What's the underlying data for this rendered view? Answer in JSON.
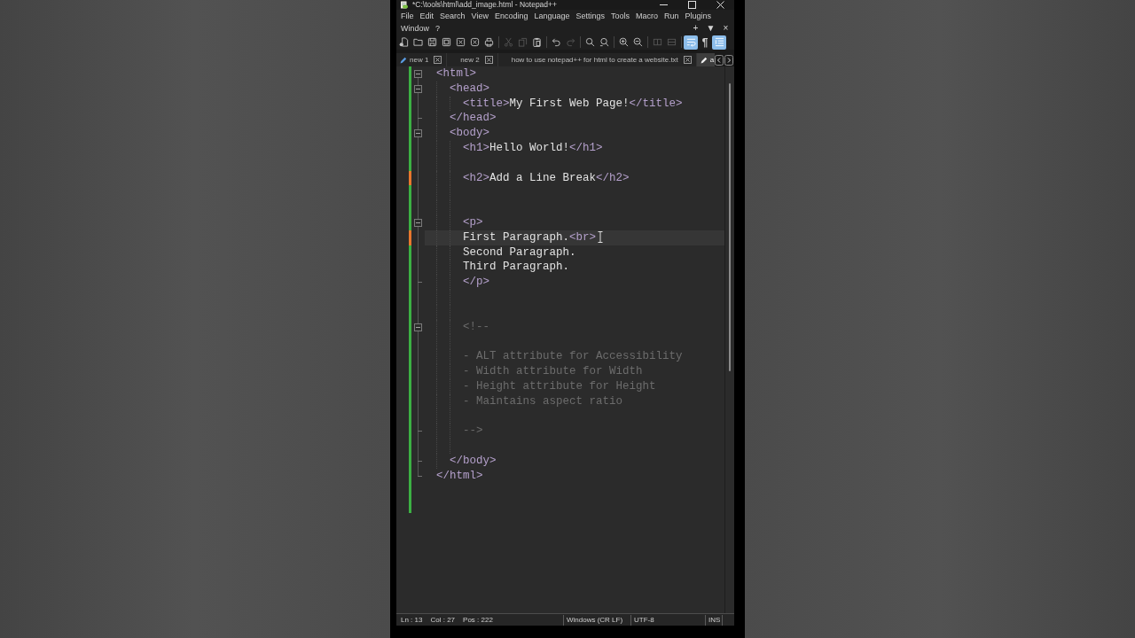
{
  "title_bar": {
    "title": "*C:\\tools\\html\\add_image.html - Notepad++"
  },
  "menu_rows": [
    [
      "File",
      "Edit",
      "Search",
      "View",
      "Encoding",
      "Language",
      "Settings",
      "Tools",
      "Macro",
      "Run",
      "Plugins"
    ],
    [
      "Window",
      "?"
    ]
  ],
  "menu_controls": [
    "+",
    "▼",
    "×"
  ],
  "toolbar": [
    [
      {
        "kind": "icon",
        "disabled": false,
        "selected": false
      },
      {
        "kind": "icon",
        "disabled": false,
        "selected": false
      },
      {
        "kind": "icon",
        "disabled": false,
        "selected": false
      },
      {
        "kind": "icon",
        "disabled": false,
        "selected": false
      },
      {
        "kind": "icon",
        "disabled": false,
        "selected": false
      },
      {
        "kind": "icon",
        "disabled": false,
        "selected": false
      },
      {
        "kind": "icon",
        "disabled": false,
        "selected": false
      }
    ],
    [
      {
        "kind": "icon",
        "disabled": true,
        "selected": false
      },
      {
        "kind": "icon",
        "disabled": true,
        "selected": false
      },
      {
        "kind": "icon",
        "disabled": false,
        "selected": false
      }
    ],
    [
      {
        "kind": "icon",
        "disabled": false,
        "selected": false
      },
      {
        "kind": "icon",
        "disabled": true,
        "selected": false
      }
    ],
    [
      {
        "kind": "icon",
        "disabled": false,
        "selected": false
      },
      {
        "kind": "icon",
        "disabled": false,
        "selected": false
      }
    ],
    [
      {
        "kind": "icon",
        "disabled": false,
        "selected": false
      },
      {
        "kind": "icon",
        "disabled": false,
        "selected": false
      }
    ],
    [
      {
        "kind": "icon",
        "disabled": true,
        "selected": false
      },
      {
        "kind": "icon",
        "disabled": true,
        "selected": false
      }
    ],
    [
      {
        "kind": "icon",
        "disabled": false,
        "selected": true
      },
      {
        "kind": "glyph",
        "label": "¶",
        "disabled": false,
        "selected": false
      },
      {
        "kind": "icon",
        "disabled": false,
        "selected": true
      }
    ]
  ],
  "tabs": [
    {
      "label": "new 1",
      "modified": true,
      "closable": true,
      "selected": false
    },
    {
      "label": "new 2",
      "modified": false,
      "closable": true,
      "selected": false
    },
    {
      "label": "how to use notepad++ for html to create a website.txt",
      "modified": false,
      "closable": true,
      "selected": false
    },
    {
      "label": "a",
      "modified": true,
      "closable": false,
      "selected": true
    }
  ],
  "editor": {
    "lines": [
      {
        "kind": "code",
        "tokens": [
          {
            "kind": "tag",
            "text": "<html>"
          }
        ],
        "fold_start": true,
        "fold_end": false,
        "modified": false,
        "current": false,
        "children": [
          {
            "kind": "code",
            "tokens": [
              {
                "kind": "tag",
                "text": "<head>"
              }
            ],
            "fold_start": true,
            "fold_end": false,
            "modified": false,
            "current": false,
            "children": [
              {
                "kind": "code",
                "tokens": [
                  {
                    "kind": "tag",
                    "text": "<title>"
                  },
                  {
                    "kind": "text",
                    "text": "My First Web Page!"
                  },
                  {
                    "kind": "tag",
                    "text": "</title>"
                  }
                ],
                "fold_start": false,
                "fold_end": false,
                "modified": false,
                "current": false
              }
            ]
          },
          {
            "kind": "code",
            "tokens": [
              {
                "kind": "tag",
                "text": "</head>"
              }
            ],
            "fold_start": false,
            "fold_end": true,
            "modified": false,
            "current": false
          },
          {
            "kind": "code",
            "tokens": [
              {
                "kind": "tag",
                "text": "<body>"
              }
            ],
            "fold_start": true,
            "fold_end": false,
            "modified": false,
            "current": false,
            "children": [
              {
                "kind": "code",
                "tokens": [
                  {
                    "kind": "tag",
                    "text": "<h1>"
                  },
                  {
                    "kind": "text",
                    "text": "Hello World!"
                  },
                  {
                    "kind": "tag",
                    "text": "</h1>"
                  }
                ],
                "fold_start": false,
                "fold_end": false,
                "modified": false,
                "current": false
              },
              {
                "kind": "blank",
                "fold_start": false,
                "fold_end": false,
                "modified": false,
                "current": false
              },
              {
                "kind": "code",
                "tokens": [
                  {
                    "kind": "tag",
                    "text": "<h2>"
                  },
                  {
                    "kind": "text",
                    "text": "Add a Line Break"
                  },
                  {
                    "kind": "tag",
                    "text": "</h2>"
                  }
                ],
                "fold_start": false,
                "fold_end": false,
                "modified": true,
                "current": false
              },
              {
                "kind": "blank",
                "fold_start": false,
                "fold_end": false,
                "modified": false,
                "current": false
              },
              {
                "kind": "blank",
                "fold_start": false,
                "fold_end": false,
                "modified": false,
                "current": false
              },
              {
                "kind": "code",
                "tokens": [
                  {
                    "kind": "tag",
                    "text": "<p>"
                  }
                ],
                "fold_start": true,
                "fold_end": false,
                "modified": false,
                "current": false
              },
              {
                "kind": "code",
                "tokens": [
                  {
                    "kind": "text",
                    "text": "First Paragraph."
                  },
                  {
                    "kind": "tag",
                    "text": "<br>"
                  }
                ],
                "fold_start": false,
                "fold_end": false,
                "modified": true,
                "current": true
              },
              {
                "kind": "code",
                "tokens": [
                  {
                    "kind": "text",
                    "text": "Second Paragraph."
                  }
                ],
                "fold_start": false,
                "fold_end": false,
                "modified": false,
                "current": false
              },
              {
                "kind": "code",
                "tokens": [
                  {
                    "kind": "text",
                    "text": "Third Paragraph."
                  }
                ],
                "fold_start": false,
                "fold_end": false,
                "modified": false,
                "current": false
              },
              {
                "kind": "code",
                "tokens": [
                  {
                    "kind": "tag",
                    "text": "</p>"
                  }
                ],
                "fold_start": false,
                "fold_end": true,
                "modified": false,
                "current": false
              },
              {
                "kind": "blank",
                "fold_start": false,
                "fold_end": false,
                "modified": false,
                "current": false
              },
              {
                "kind": "blank",
                "fold_start": false,
                "fold_end": false,
                "modified": false,
                "current": false
              },
              {
                "kind": "code",
                "tokens": [
                  {
                    "kind": "comment",
                    "text": "<!--"
                  }
                ],
                "fold_start": true,
                "fold_end": false,
                "modified": false,
                "current": false
              },
              {
                "kind": "blank",
                "fold_start": false,
                "fold_end": false,
                "modified": false,
                "current": false
              },
              {
                "kind": "code",
                "tokens": [
                  {
                    "kind": "comment",
                    "text": "- ALT attribute for Accessibility"
                  }
                ],
                "fold_start": false,
                "fold_end": false,
                "modified": false,
                "current": false
              },
              {
                "kind": "code",
                "tokens": [
                  {
                    "kind": "comment",
                    "text": "- Width attribute for Width"
                  }
                ],
                "fold_start": false,
                "fold_end": false,
                "modified": false,
                "current": false
              },
              {
                "kind": "code",
                "tokens": [
                  {
                    "kind": "comment",
                    "text": "- Height attribute for Height"
                  }
                ],
                "fold_start": false,
                "fold_end": false,
                "modified": false,
                "current": false
              },
              {
                "kind": "code",
                "tokens": [
                  {
                    "kind": "comment",
                    "text": "- Maintains aspect ratio"
                  }
                ],
                "fold_start": false,
                "fold_end": false,
                "modified": false,
                "current": false
              },
              {
                "kind": "blank",
                "fold_start": false,
                "fold_end": false,
                "modified": false,
                "current": false
              },
              {
                "kind": "code",
                "tokens": [
                  {
                    "kind": "comment",
                    "text": "-->"
                  }
                ],
                "fold_start": false,
                "fold_end": true,
                "modified": false,
                "current": false
              },
              {
                "kind": "blank",
                "fold_start": false,
                "fold_end": false,
                "modified": false,
                "current": false
              }
            ]
          },
          {
            "kind": "code",
            "tokens": [
              {
                "kind": "tag",
                "text": "</body>"
              }
            ],
            "fold_start": false,
            "fold_end": true,
            "modified": false,
            "current": false
          }
        ]
      },
      {
        "kind": "code",
        "tokens": [
          {
            "kind": "tag",
            "text": "</html>"
          }
        ],
        "fold_start": false,
        "fold_end": true,
        "modified": false,
        "current": false
      },
      {
        "kind": "blank",
        "fold_start": false,
        "fold_end": false,
        "modified": false,
        "current": false
      },
      {
        "kind": "blank",
        "fold_start": false,
        "fold_end": false,
        "modified": false,
        "current": false
      }
    ]
  },
  "status_bar": {
    "position": [
      "Ln : 13",
      "Col : 27",
      "Pos : 222"
    ],
    "line_ending": "Windows (CR LF)",
    "encoding": "UTF-8",
    "mode": "INS"
  }
}
